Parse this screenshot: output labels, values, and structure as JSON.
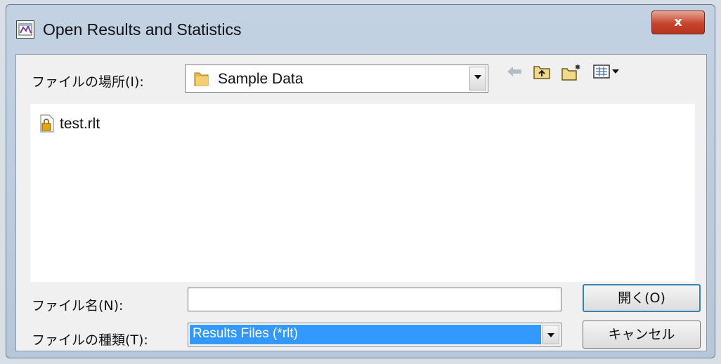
{
  "window": {
    "title": "Open Results and Statistics",
    "close_label": "x"
  },
  "lookin": {
    "label": "ファイルの場所(I):",
    "value": "Sample Data"
  },
  "files": [
    {
      "name": "test.rlt"
    }
  ],
  "filename": {
    "label": "ファイル名(N):",
    "value": ""
  },
  "filetype": {
    "label": "ファイルの種類(T):",
    "value": "Results Files (*rlt)"
  },
  "buttons": {
    "open": "開く(O)",
    "cancel": "キャンセル"
  },
  "icons": {
    "app": "app-icon",
    "folder": "folder-icon",
    "back": "back-arrow-icon",
    "up": "up-folder-icon",
    "new_folder": "new-folder-icon",
    "view_menu": "view-menu-icon",
    "file": "file-icon"
  },
  "colors": {
    "titlebar": "#c3d2e3",
    "close": "#c6442d",
    "selection": "#3399ff",
    "client": "#f0f0f0"
  }
}
